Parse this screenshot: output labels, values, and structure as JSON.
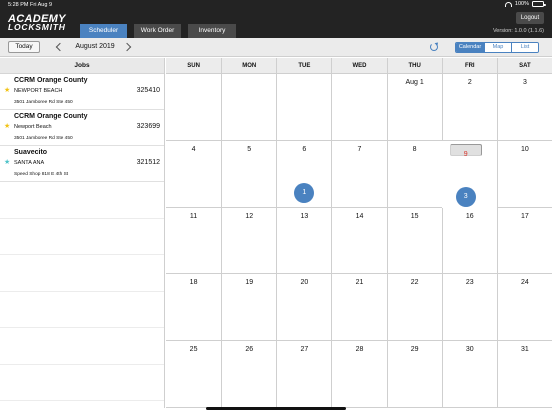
{
  "status_bar": {
    "time": "5:28 PM",
    "date": "Fri Aug 9",
    "battery": "100%"
  },
  "header": {
    "logo_line1": "ACADEMY",
    "logo_line2": "LOCKSMITH",
    "tabs": [
      {
        "label": "Scheduler"
      },
      {
        "label": "Work Order"
      },
      {
        "label": "Inventory"
      }
    ],
    "logout_label": "Logout",
    "version": "Version: 1.0.0 (1.1.6)"
  },
  "toolbar": {
    "today_label": "Today",
    "month": "August 2019",
    "views": [
      {
        "label": "Calendar"
      },
      {
        "label": "Map"
      },
      {
        "label": "List"
      }
    ]
  },
  "jobs": {
    "header": "Jobs",
    "items": [
      {
        "name": "CCRM Orange County",
        "city": "NEWPORT BEACH",
        "number": "325410",
        "address": "3501 Jamboree Rd Ste 450",
        "star_color": "#f2c315"
      },
      {
        "name": "CCRM Orange County",
        "city": "Newport Beach",
        "number": "323699",
        "address": "3501 Jamboree Rd Ste 450",
        "star_color": "#f2c315"
      },
      {
        "name": "Suavecito",
        "city": "SANTA ANA",
        "number": "321512",
        "address": "Speed Shop 818 E 4th St",
        "star_color": "#4fc3c9"
      }
    ]
  },
  "calendar": {
    "days": [
      "SUN",
      "MON",
      "TUE",
      "WED",
      "THU",
      "FRI",
      "SAT"
    ],
    "cells": [
      {
        "d": ""
      },
      {
        "d": ""
      },
      {
        "d": ""
      },
      {
        "d": ""
      },
      {
        "d": "Aug 1"
      },
      {
        "d": "2"
      },
      {
        "d": "3"
      },
      {
        "d": "4"
      },
      {
        "d": "5"
      },
      {
        "d": "6",
        "count": "1"
      },
      {
        "d": "7"
      },
      {
        "d": "8"
      },
      {
        "d": "9",
        "count": "3",
        "today": true
      },
      {
        "d": "10"
      },
      {
        "d": "11"
      },
      {
        "d": "12"
      },
      {
        "d": "13"
      },
      {
        "d": "14"
      },
      {
        "d": "15"
      },
      {
        "d": "16"
      },
      {
        "d": "17"
      },
      {
        "d": "18"
      },
      {
        "d": "19"
      },
      {
        "d": "20"
      },
      {
        "d": "21"
      },
      {
        "d": "22"
      },
      {
        "d": "23"
      },
      {
        "d": "24"
      },
      {
        "d": "25"
      },
      {
        "d": "26"
      },
      {
        "d": "27"
      },
      {
        "d": "28"
      },
      {
        "d": "29"
      },
      {
        "d": "30"
      },
      {
        "d": "31"
      }
    ]
  },
  "colors": {
    "accent": "#4a82c0",
    "header_bg": "#232323",
    "today_text": "#d9342b"
  }
}
